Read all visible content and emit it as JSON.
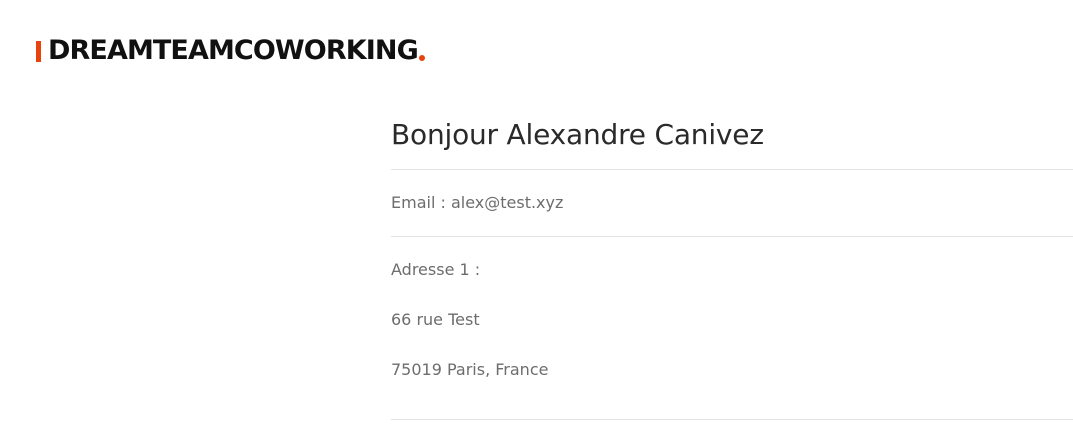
{
  "brand": {
    "name": "DREAMTEAMCOWORKING",
    "accent_color": "#e8420f"
  },
  "profile": {
    "greeting": "Bonjour Alexandre Canivez",
    "email_line": "Email : alex@test.xyz",
    "address_label": "Adresse 1 :",
    "address_street": "66 rue Test",
    "address_city": "75019 Paris, France"
  }
}
